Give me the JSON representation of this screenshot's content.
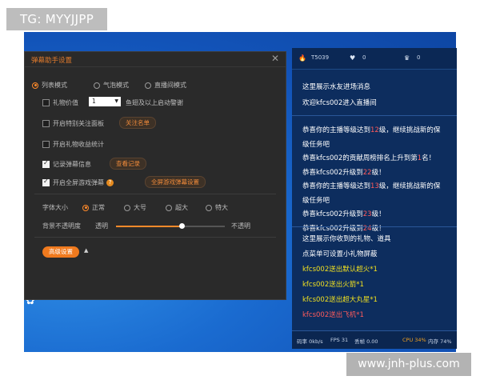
{
  "watermarks": {
    "top_left": "TG: MYYJJPP",
    "bottom_right": "www.jnh-plus.com"
  },
  "dialog": {
    "title": "弹幕助手设置",
    "close_glyph": "✕",
    "mode_options": [
      {
        "label": "列表模式",
        "selected": true
      },
      {
        "label": "气泡模式",
        "selected": false
      },
      {
        "label": "直播间模式",
        "selected": false
      }
    ],
    "gift_value": {
      "label": "礼物价值",
      "checked": false,
      "select_value": "1",
      "suffix": "鱼翅及以上启动警谢"
    },
    "special_follow": {
      "label": "开启特别关注面板",
      "checked": false,
      "button": "关注名单"
    },
    "gift_income": {
      "label": "开启礼物收益统计",
      "checked": false
    },
    "record_danmu": {
      "label": "记录弹幕信息",
      "checked": true,
      "button": "查看记录"
    },
    "fullscreen_game": {
      "label": "开启全屏游戏弹幕",
      "checked": true,
      "info_glyph": "?",
      "button": "全屏游戏弹幕设置"
    },
    "font_size": {
      "label": "字体大小",
      "options": [
        {
          "label": "正常",
          "selected": true
        },
        {
          "label": "大号",
          "selected": false
        },
        {
          "label": "超大",
          "selected": false
        },
        {
          "label": "特大",
          "selected": false
        }
      ]
    },
    "opacity": {
      "label": "背景不透明度",
      "min_label": "透明",
      "max_label": "不透明",
      "value_fraction": 0.6
    },
    "advanced": {
      "label": "高级设置",
      "caret": "▲"
    }
  },
  "panel": {
    "top": {
      "flame_icon_glyph": "🔥",
      "count1": "T5039",
      "heart_icon_glyph": "♥",
      "count2": "0",
      "crown_icon_glyph": "♛",
      "count3": "0"
    },
    "section1": [
      {
        "text": "这里展示水友进场消息"
      },
      {
        "text": "欢迎kfcs002进入直播间"
      }
    ],
    "section2": [
      {
        "pre": "恭喜你的主播等级达到",
        "hl": "12",
        "post": "级，继续挑战新的保"
      },
      {
        "pre": "级任务吧",
        "hl": "",
        "post": ""
      },
      {
        "pre": "恭喜kfcs002的贡献周榜排名上升到第",
        "hl": "1",
        "post": "名！"
      },
      {
        "pre": "恭喜kfcs002升级到",
        "hl": "22",
        "post": "级！"
      },
      {
        "pre": "恭喜你的主播等级达到",
        "hl": "13",
        "post": "级，继续挑战新的保"
      },
      {
        "pre": "级任务吧",
        "hl": "",
        "post": ""
      },
      {
        "pre": "恭喜kfcs002升级到",
        "hl": "23",
        "post": "级！"
      },
      {
        "pre": "恭喜kfcs002升级到",
        "hl": "24",
        "post": "级！"
      }
    ],
    "section3": [
      {
        "pre": "这里展示你收到的礼物、道具",
        "gift": "",
        "cls": ""
      },
      {
        "pre": "点菜单可设置小礼物屏蔽",
        "gift": "",
        "cls": ""
      },
      {
        "pre": "kfcs002送出",
        "gift": "默认超火*1",
        "cls": "gold"
      },
      {
        "pre": "kfcs002送出",
        "gift": "火箭*1",
        "cls": "gold"
      },
      {
        "pre": "kfcs002送出",
        "gift": "超大丸星*1",
        "cls": "gold"
      },
      {
        "pre": "kfcs002送出",
        "gift": "飞机*1",
        "cls": "hl"
      }
    ],
    "status": {
      "rate": "码率 0kb/s",
      "fps": "FPS 31",
      "drop": "丢帧 0.00",
      "cpu": "CPU 34%",
      "mem": "内存 74%"
    }
  }
}
